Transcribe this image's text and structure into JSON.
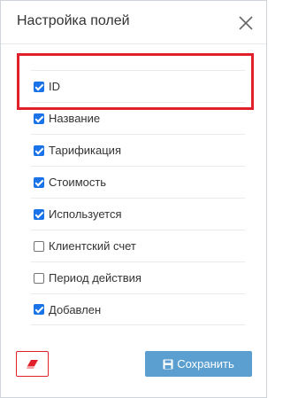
{
  "dialog": {
    "title": "Настройка полей",
    "close_icon": "close-icon"
  },
  "fields": [
    {
      "label": "ID",
      "checked": true
    },
    {
      "label": "Название",
      "checked": true
    },
    {
      "label": "Тарификация",
      "checked": true
    },
    {
      "label": "Стоимость",
      "checked": true
    },
    {
      "label": "Используется",
      "checked": true
    },
    {
      "label": "Клиентский счет",
      "checked": false
    },
    {
      "label": "Период действия",
      "checked": false
    },
    {
      "label": "Добавлен",
      "checked": true
    }
  ],
  "footer": {
    "reset_icon": "eraser-icon",
    "save_label": "Сохранить",
    "save_icon": "floppy-disk-icon"
  },
  "colors": {
    "accent": "#1a73e8",
    "save_button": "#5b9fd0",
    "highlight": "#e0202a"
  }
}
